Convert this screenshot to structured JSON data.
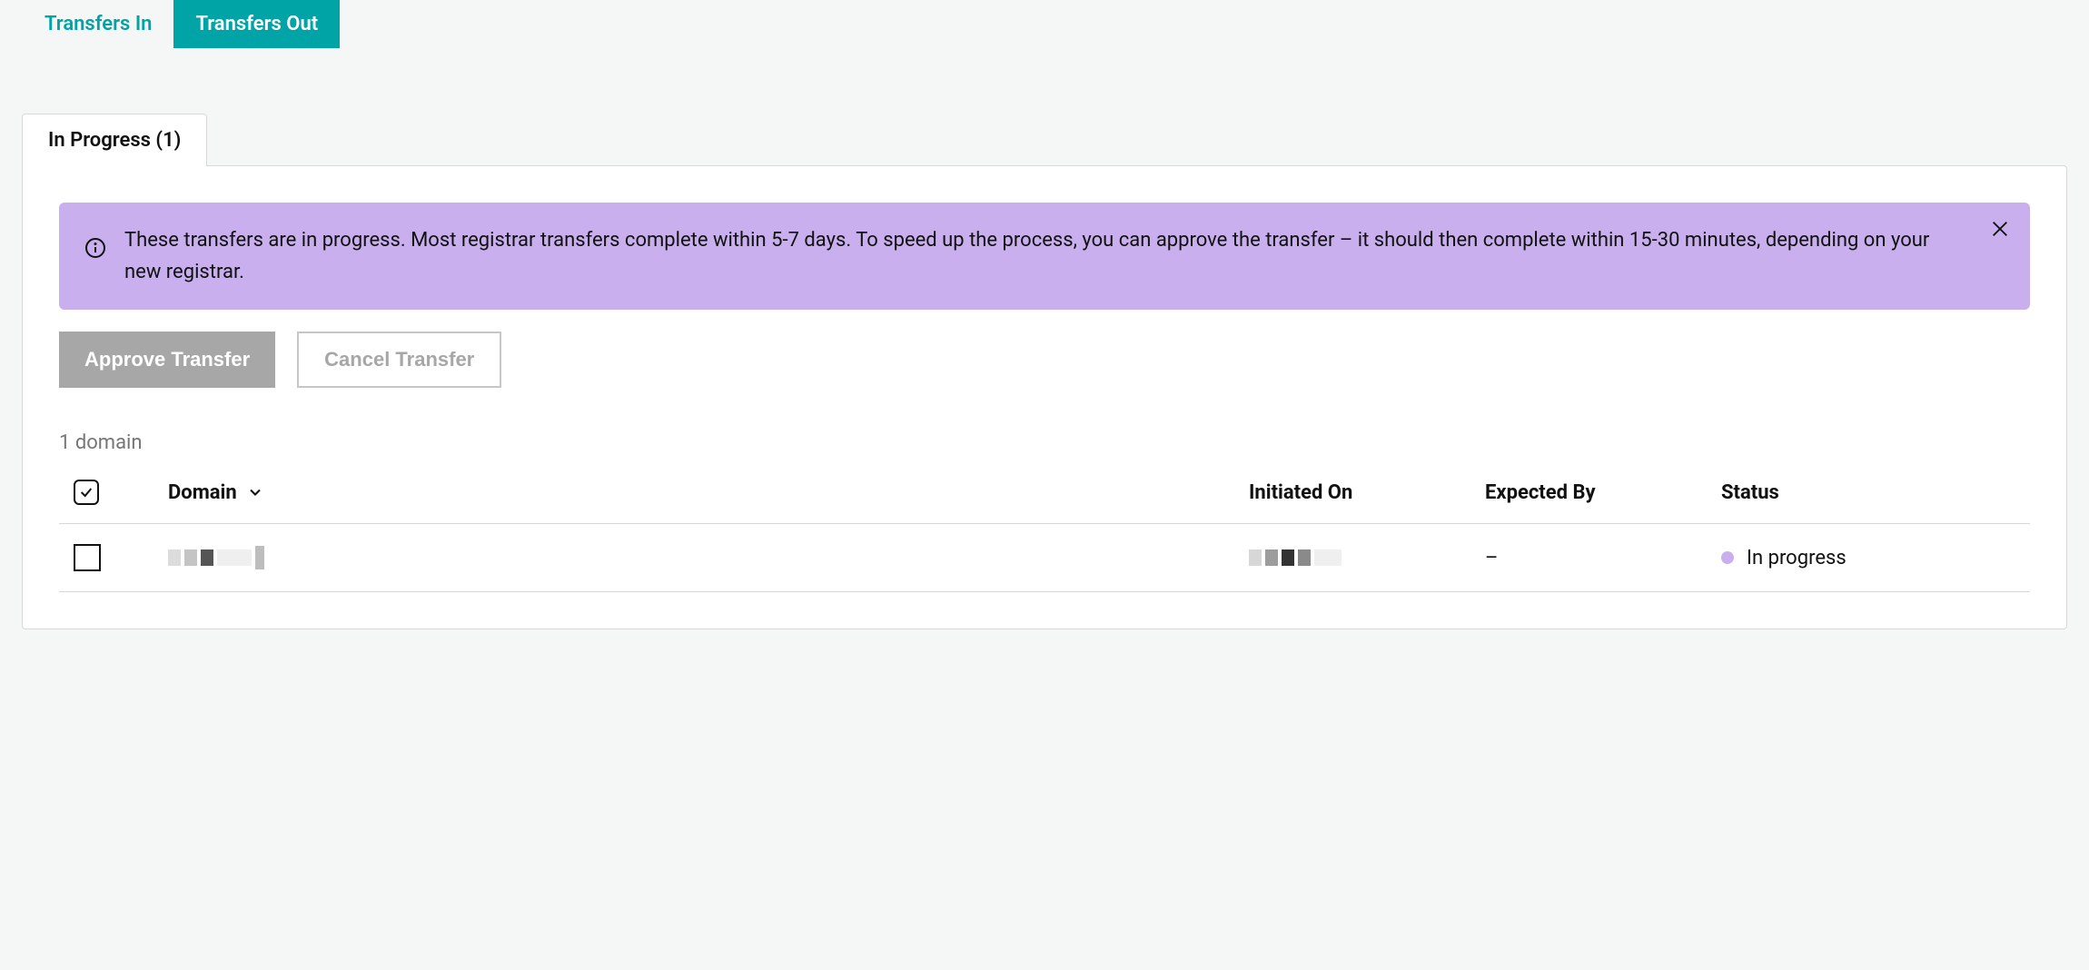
{
  "topTabs": {
    "transfersIn": "Transfers In",
    "transfersOut": "Transfers Out"
  },
  "subTab": {
    "label": "In Progress (1)"
  },
  "banner": {
    "text": "These transfers are in progress. Most registrar transfers complete within 5-7 days. To speed up the process, you can approve the transfer – it should then complete within 15-30 minutes, depending on your new registrar."
  },
  "actions": {
    "approve": "Approve Transfer",
    "cancel": "Cancel Transfer"
  },
  "countLine": "1 domain",
  "table": {
    "headers": {
      "domain": "Domain",
      "initiated": "Initiated On",
      "expected": "Expected By",
      "status": "Status"
    },
    "rows": [
      {
        "domain": "",
        "initiated": "",
        "expected": "–",
        "status": "In progress"
      }
    ]
  }
}
